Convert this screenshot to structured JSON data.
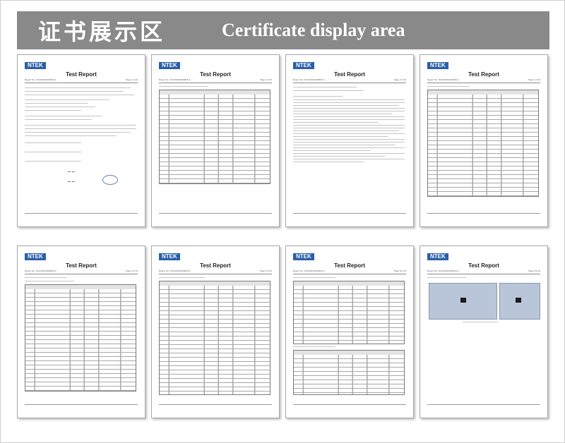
{
  "banner": {
    "title_cn": "证书展示区",
    "title_en": "Certificate display area"
  },
  "brand": {
    "accent": "#2a5fa8",
    "banner_bg": "#898989"
  },
  "pages": [
    {
      "logo": "NTEK",
      "title": "Test Report",
      "report_no": "Report No.: DGC190111002RS-A",
      "page": "Page 1 of 19"
    },
    {
      "logo": "NTEK",
      "title": "Test Report",
      "report_no": "Report No.: DGC190111002RS-A",
      "page": "Page 2 of 19"
    },
    {
      "logo": "NTEK",
      "title": "Test Report",
      "report_no": "Report No.: DGC190111002RS-A",
      "page": "Page 3 of 19"
    },
    {
      "logo": "NTEK",
      "title": "Test Report",
      "report_no": "Report No.: DGC190111002RS-A",
      "page": "Page 4 of 19"
    },
    {
      "logo": "NTEK",
      "title": "Test Report",
      "report_no": "Report No.: DGC190111002RS-A",
      "page": "Page 5 of 19"
    },
    {
      "logo": "NTEK",
      "title": "Test Report",
      "report_no": "Report No.: DGC190111002RS-A",
      "page": "Page 6 of 19"
    },
    {
      "logo": "NTEK",
      "title": "Test Report",
      "report_no": "Report No.: DGC190111002RS-A",
      "page": "Page 8 of 19"
    },
    {
      "logo": "NTEK",
      "title": "Test Report",
      "report_no": "Report No.: DGC190111002RS-A",
      "page": "Page 9 of 19"
    }
  ]
}
